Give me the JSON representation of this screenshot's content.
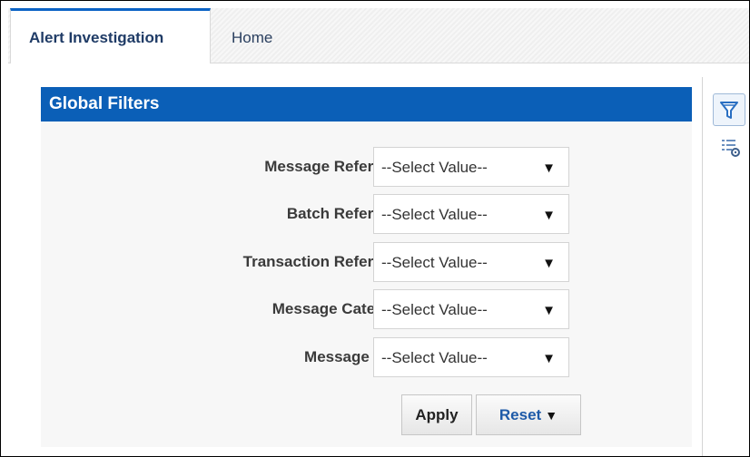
{
  "tabs": [
    {
      "label": "Alert Investigation",
      "active": true
    },
    {
      "label": "Home",
      "active": false
    }
  ],
  "panel": {
    "title": "Global Filters",
    "header_color": "#0b5fb7"
  },
  "filters": [
    {
      "label": "Message Reference",
      "value": "--Select Value--"
    },
    {
      "label": "Batch Reference",
      "value": "--Select Value--"
    },
    {
      "label": "Transaction Reference",
      "value": "--Select Value--"
    },
    {
      "label": "Message Category",
      "value": "--Select Value--"
    },
    {
      "label": "Message Type",
      "value": "--Select Value--"
    }
  ],
  "buttons": {
    "apply": "Apply",
    "reset": "Reset",
    "reset_caret": "▼"
  },
  "dropdown_arrow": "▼",
  "side_icons": [
    "filter-icon",
    "list-settings-icon"
  ],
  "accent_color": "#0b63c5"
}
